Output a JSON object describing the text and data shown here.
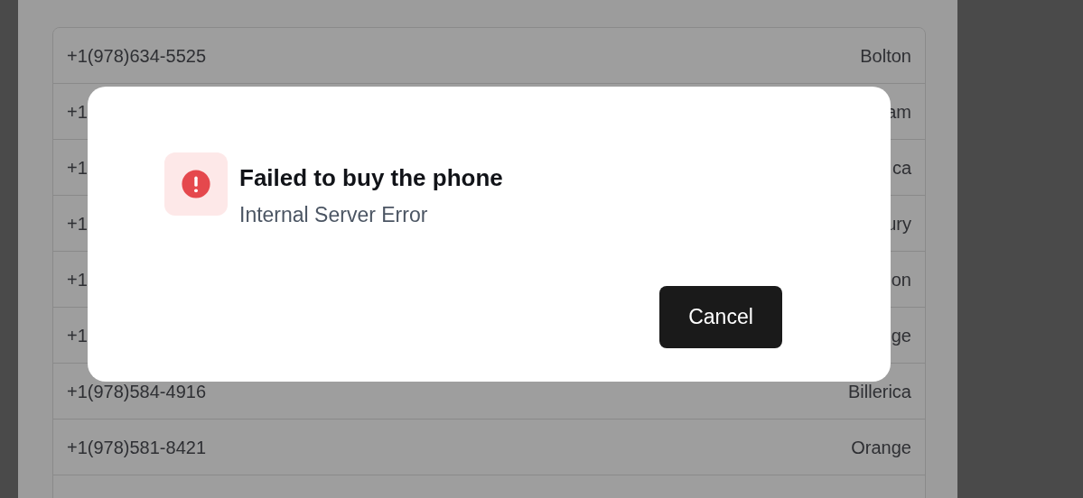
{
  "numbers_list": {
    "rows": [
      {
        "phone": "+1(978)634-5525",
        "city": "Bolton"
      },
      {
        "phone": "+1",
        "city": "am"
      },
      {
        "phone": "+1",
        "city": "ca"
      },
      {
        "phone": "+1",
        "city": "ury"
      },
      {
        "phone": "+1",
        "city": "on"
      },
      {
        "phone": "+1",
        "city": "ge"
      },
      {
        "phone": "+1(978)584-4916",
        "city": "Billerica"
      },
      {
        "phone": "+1(978)581-8421",
        "city": "Orange"
      }
    ]
  },
  "dialog": {
    "title": "Failed to buy the phone",
    "message": "Internal Server Error",
    "buttons": [
      "Cancel"
    ]
  }
}
